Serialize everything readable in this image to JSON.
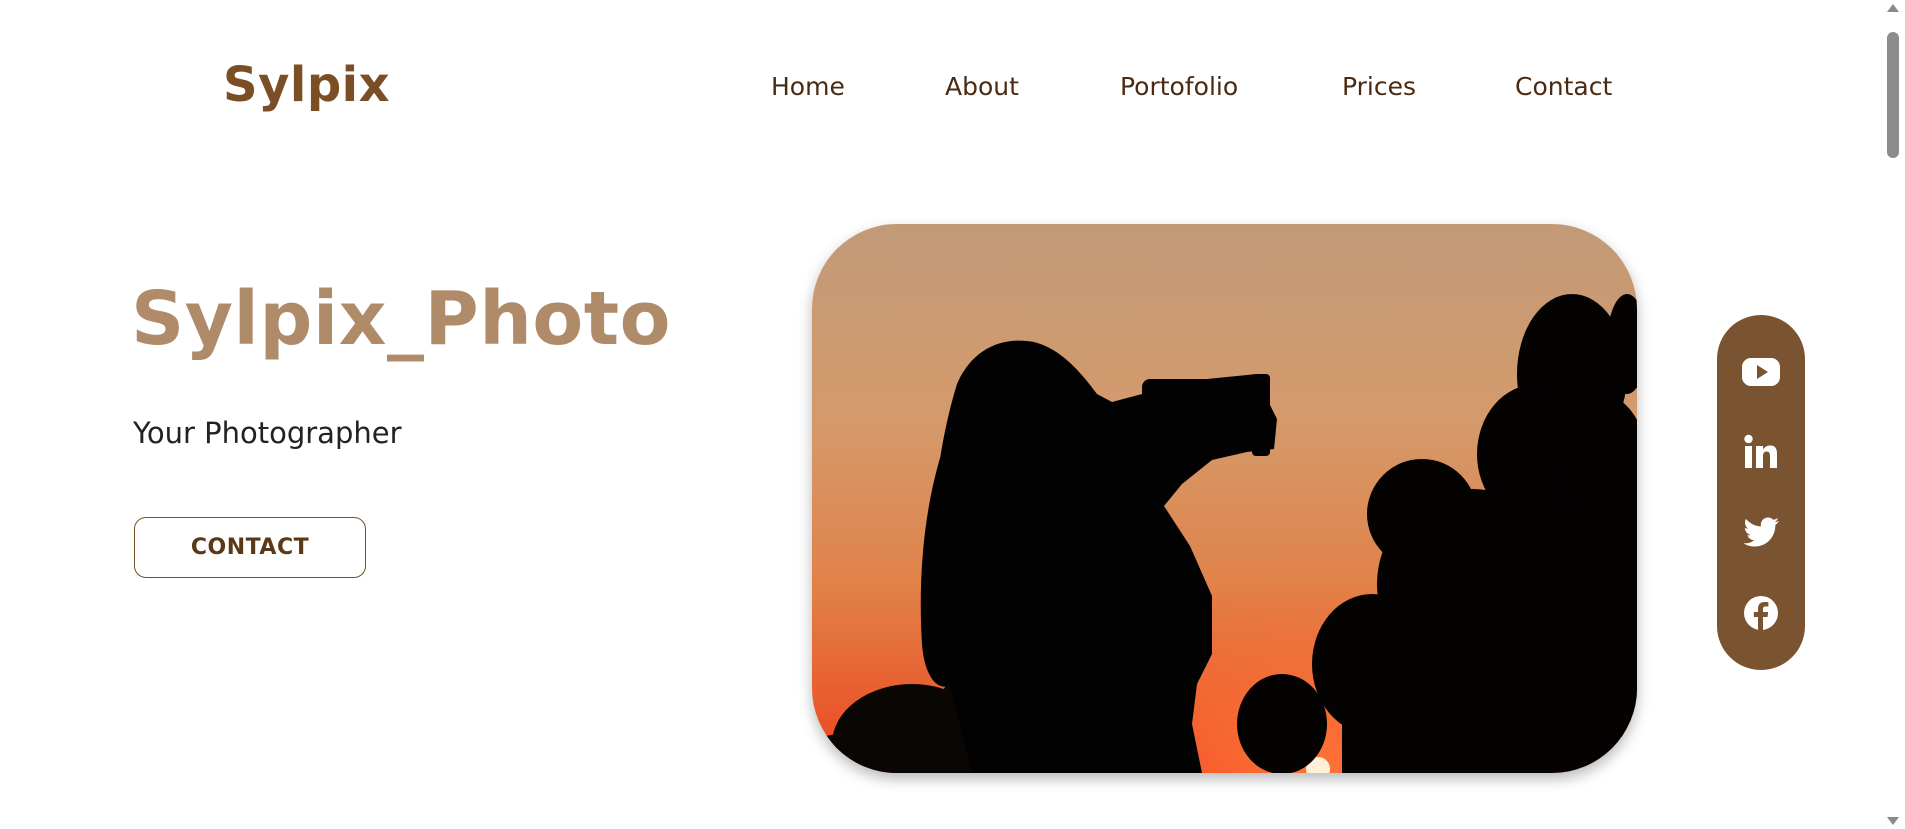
{
  "brand": {
    "name": "Sylpix"
  },
  "nav": {
    "items": [
      {
        "label": "Home"
      },
      {
        "label": "About"
      },
      {
        "label": "Portofolio"
      },
      {
        "label": "Prices"
      },
      {
        "label": "Contact"
      }
    ]
  },
  "hero": {
    "title": "Sylpix_Photo",
    "subtitle": "Your Photographer",
    "button_label": "CONTACT"
  },
  "social": {
    "icons": [
      "youtube-icon",
      "linkedin-icon",
      "twitter-icon",
      "facebook-icon"
    ]
  },
  "colors": {
    "brand": "#7a4f25",
    "title_accent": "#b08b6a",
    "social_bar": "#7a5430",
    "nav_text": "#4a2a12"
  }
}
